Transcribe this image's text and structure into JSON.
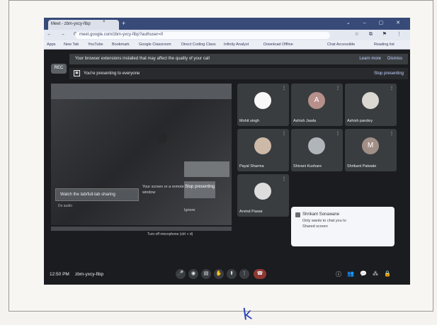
{
  "browser": {
    "tab_title": "Meet - zbm-yxcy-fibp",
    "tab_close": "×",
    "new_tab": "+",
    "window_controls": "⌄ – ▢ ✕",
    "nav_icons": "← → ⟳",
    "url": "meet.google.com/zbm-yxcy-fibp?authuser=0",
    "url_right_icons": "☆ ⧉ ⚑ ⋮",
    "bookmarks": [
      "Apps",
      "New Tab",
      "YouTube",
      "Bookmark",
      "Google Classroom",
      "Direct Coding Class",
      "Infinity Analyst",
      "Download Offline",
      "Chat Accessible",
      "Reading list"
    ]
  },
  "meet": {
    "banner_text": "Your browser extensions installed that may affect the quality of your call",
    "banner_learn": "Learn more",
    "banner_dismiss": "Dismiss",
    "rec_label": "REC",
    "presenting_text": "You're presenting to everyone",
    "stop_presenting": "Stop presenting",
    "share_alert_button": "Watch the tab/full-tab sharing",
    "share_alert_sub": "Do audio",
    "share_alert_text": "Your screen or a remote window",
    "share_present_button": "Stop presenting",
    "share_ignore": "Ignore",
    "turn_off_mic": "Turn off microphone (ctrl + d)",
    "tiles": [
      {
        "name": "Mohit singh",
        "initial": "",
        "avatar_color": "#f2f2f2"
      },
      {
        "name": "Ashish Jawla",
        "initial": "A",
        "avatar_color": "#b48f8a"
      },
      {
        "name": "Ashish pandey",
        "initial": "",
        "avatar_color": "#d7d3cd"
      },
      {
        "name": "Payal Sharma",
        "initial": "",
        "avatar_color": "#c9b6a6"
      },
      {
        "name": "Shivani Kushare",
        "initial": "",
        "avatar_color": "#aeb2b7"
      },
      {
        "name": "Shrikant Patwale",
        "initial": "M",
        "avatar_color": "#9e8e86"
      },
      {
        "name": "Arvind Pawar",
        "initial": "",
        "avatar_color": "#d9d9d9"
      }
    ],
    "notification": {
      "title": "Shrikant Sonawane",
      "line1": "Only wants to chat you to",
      "line2": "Shared screen"
    },
    "clock": "12:50 PM",
    "meet_code": "zbm-yxcy-fibp",
    "controls": [
      "mic-icon",
      "camera-icon",
      "captions-icon",
      "hand-icon",
      "present-icon",
      "more-icon",
      "end-call-icon"
    ],
    "right_controls": [
      "info-icon",
      "people-icon",
      "chat-icon",
      "activities-icon",
      "lock-icon"
    ]
  },
  "annotation": "k"
}
